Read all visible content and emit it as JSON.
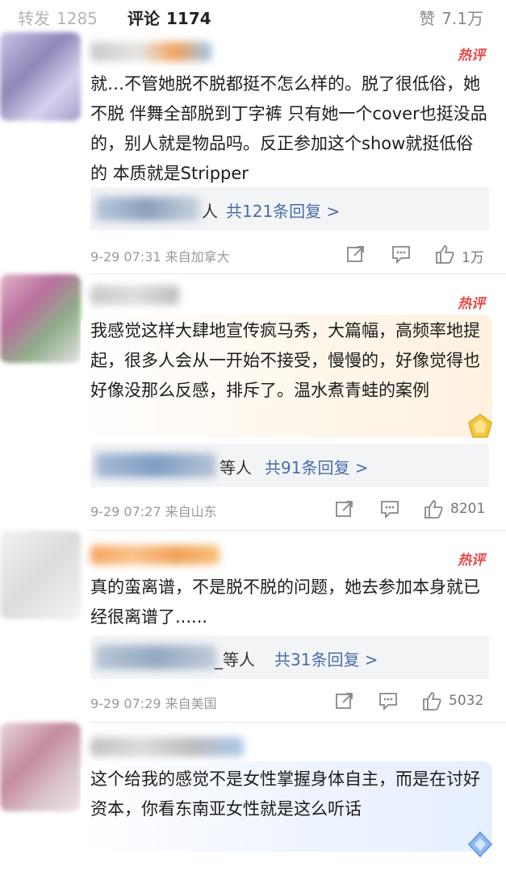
{
  "topbar": {
    "repost_label": "转发",
    "repost_count": "1285",
    "comment_label": "评论",
    "comment_count": "1174",
    "like_label": "赞",
    "like_count": "7.1万"
  },
  "hot_label": "热评",
  "comments": [
    {
      "text": "就…不管她脱不脱都挺不怎么样的。脱了很低俗，她不脱 伴舞全部脱到丁字裤 只有她一个cover也挺没品的，别人就是物品吗。反正参加这个show就挺低俗的 本质就是Stripper",
      "reply_who": "人",
      "reply_link": "共121条回复 >",
      "time": "9-29 07:31 来自加拿大",
      "likes": "1万"
    },
    {
      "text": "我感觉这样大肆地宣传疯马秀，大篇幅，高频率地提起，很多人会从一开始不接受，慢慢的，好像觉得也好像没那么反感，排斥了。温水煮青蛙的案例",
      "reply_who": "等人",
      "reply_link": "共91条回复 >",
      "time": "9-29 07:27 来自山东",
      "likes": "8201"
    },
    {
      "text": "真的蛮离谱，不是脱不脱的问题，她去参加本身就已经很离谱了......",
      "reply_who": "_等人",
      "reply_link": "共31条回复 >",
      "time": "9-29 07:29 来自美国",
      "likes": "5032"
    },
    {
      "text": "这个给我的感觉不是女性掌握身体自主，而是在讨好资本，你看东南亚女性就是这么听话"
    }
  ],
  "icons": [
    "repost-icon",
    "reply-icon",
    "like-icon",
    "badge-icon"
  ],
  "colors": {
    "hot": "#e84848",
    "link": "#4a6ca8",
    "meta": "#9a9a9a"
  }
}
